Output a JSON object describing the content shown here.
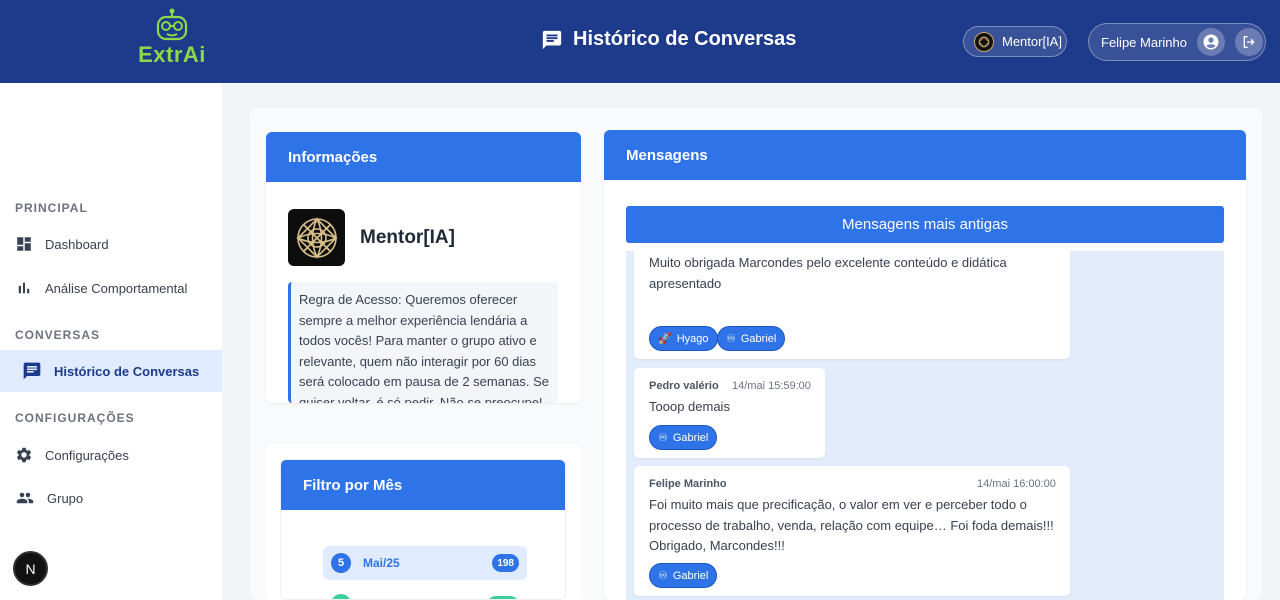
{
  "header": {
    "logo_text": "ExtrAi",
    "title": "Histórico de Conversas",
    "mentor_pill": "Mentor[IA]",
    "user_name": "Felipe Marinho"
  },
  "sidebar": {
    "sections": [
      {
        "label": "PRINCIPAL"
      },
      {
        "label": "CONVERSAS"
      },
      {
        "label": "CONFIGURAÇÕES"
      }
    ],
    "items": [
      {
        "label": "Dashboard",
        "icon": "dashboard-icon"
      },
      {
        "label": "Análise Comportamental",
        "icon": "bar-chart-icon"
      },
      {
        "label": "Histórico de Conversas",
        "icon": "chat-icon",
        "active": true
      },
      {
        "label": "Configurações",
        "icon": "gear-icon"
      },
      {
        "label": "Grupo",
        "icon": "group-icon"
      }
    ],
    "n_button": "N"
  },
  "info": {
    "title": "Informações",
    "mentor_name": "Mentor[IA]",
    "rules_text": "Regra de Acesso: Queremos oferecer sempre a melhor experiência lendária a todos vocês! Para manter o grupo ativo e relevante, quem não interagir por 60 dias será colocado em pausa de 2 semanas. Se quiser voltar, é só pedir. Não se preocupe!"
  },
  "filter": {
    "title": "Filtro por Mês",
    "months": [
      {
        "num": "5",
        "label": "Mai/25",
        "count": "198"
      }
    ]
  },
  "messages": {
    "title": "Mensagens",
    "older_button": "Mensagens mais antigas",
    "items": [
      {
        "author": "",
        "time": "",
        "text": "Muito obrigada Marcondes pelo excelente conteúdo e didática apresentado",
        "reactions": [
          {
            "emoji": "🚀",
            "name": "Hyago"
          },
          {
            "emoji": "♾",
            "name": "Gabriel"
          }
        ]
      },
      {
        "author": "Pedro valério",
        "time": "14/mai 15:59:00",
        "text": "Tooop demais",
        "reactions": [
          {
            "emoji": "♾",
            "name": "Gabriel"
          }
        ]
      },
      {
        "author": "Felipe Marinho",
        "time": "14/mai 16:00:00",
        "text": "Foi muito mais que precificação, o valor em ver e perceber todo o processo de trabalho, venda, relação com equipe… Foi foda demais!!! Obrigado, Marcondes!!!",
        "reactions": [
          {
            "emoji": "♾",
            "name": "Gabriel"
          }
        ]
      }
    ]
  },
  "colors": {
    "header_bg": "#1e3a8a",
    "accent": "#2f73e8",
    "logo_green": "#8bd84a"
  }
}
